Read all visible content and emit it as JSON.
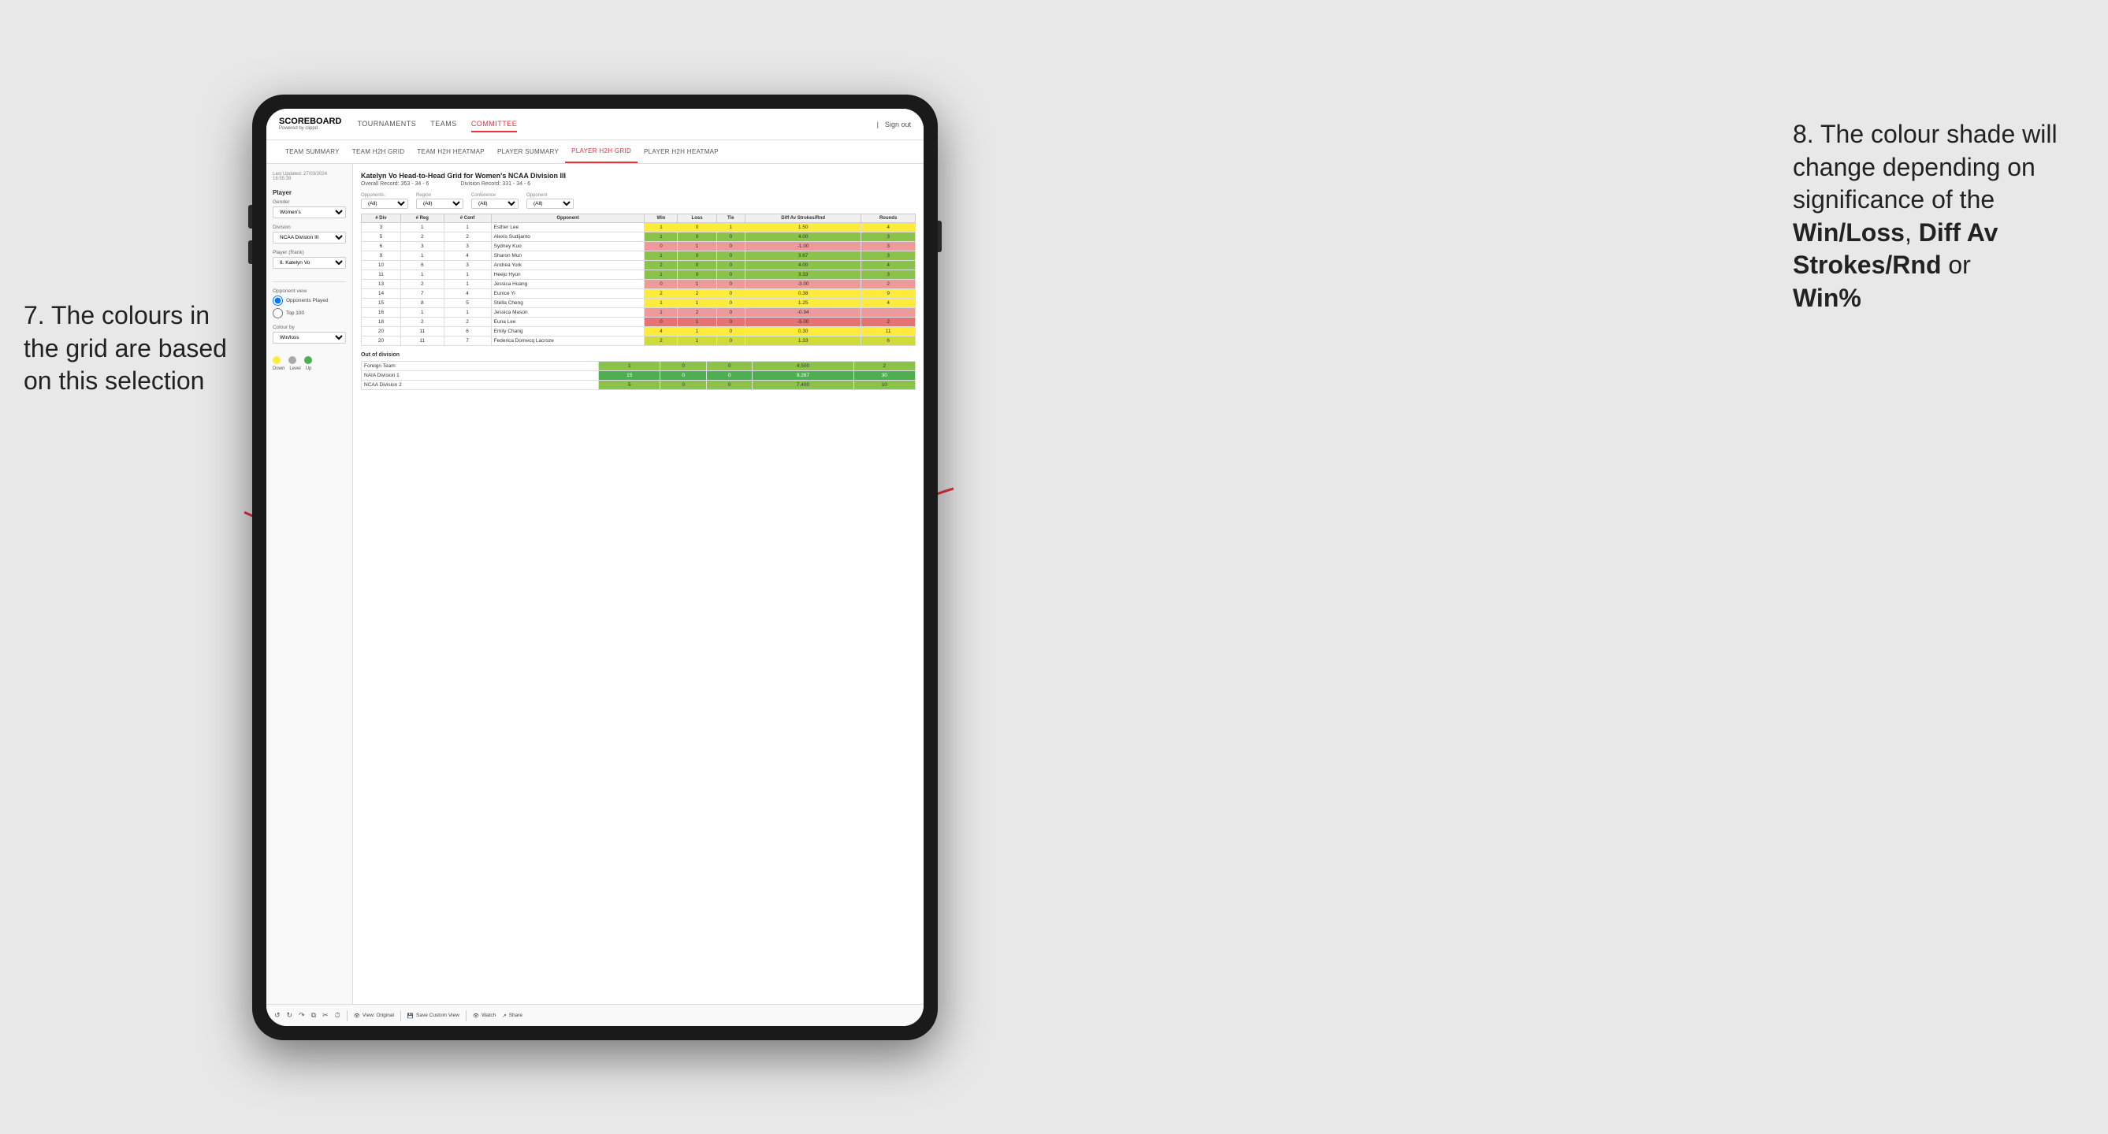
{
  "app": {
    "logo": "SCOREBOARD",
    "logo_sub": "Powered by clippd",
    "nav_items": [
      "TOURNAMENTS",
      "TEAMS",
      "COMMITTEE"
    ],
    "nav_right": [
      "Sign out"
    ],
    "sub_nav_items": [
      "TEAM SUMMARY",
      "TEAM H2H GRID",
      "TEAM H2H HEATMAP",
      "PLAYER SUMMARY",
      "PLAYER H2H GRID",
      "PLAYER H2H HEATMAP"
    ]
  },
  "sidebar": {
    "timestamp_label": "Last Updated: 27/03/2024",
    "timestamp_time": "16:55:38",
    "player_section": "Player",
    "gender_label": "Gender",
    "gender_value": "Women's",
    "division_label": "Division",
    "division_value": "NCAA Division III",
    "player_rank_label": "Player (Rank)",
    "player_rank_value": "8. Katelyn Vo",
    "opponent_view_label": "Opponent view",
    "radio_opponents": "Opponents Played",
    "radio_top100": "Top 100",
    "colour_by_label": "Colour by",
    "colour_by_value": "Win/loss",
    "legend_down": "Down",
    "legend_level": "Level",
    "legend_up": "Up"
  },
  "main": {
    "title": "Katelyn Vo Head-to-Head Grid for Women's NCAA Division III",
    "overall_record_label": "Overall Record:",
    "overall_record_value": "353 - 34 - 6",
    "division_record_label": "Division Record:",
    "division_record_value": "331 - 34 - 6",
    "filter_opponents_label": "Opponents:",
    "filter_region_label": "Region",
    "filter_conference_label": "Conference",
    "filter_opponent_label": "Opponent",
    "filter_all": "(All)",
    "columns": [
      "# Div",
      "# Reg",
      "# Conf",
      "Opponent",
      "Win",
      "Loss",
      "Tie",
      "Diff Av Strokes/Rnd",
      "Rounds"
    ],
    "rows": [
      {
        "div": "3",
        "reg": "1",
        "conf": "1",
        "name": "Esther Lee",
        "win": "1",
        "loss": "0",
        "tie": "1",
        "diff": "1.50",
        "rounds": "4",
        "color": "yellow"
      },
      {
        "div": "5",
        "reg": "2",
        "conf": "2",
        "name": "Alexis Sudijanto",
        "win": "1",
        "loss": "0",
        "tie": "0",
        "diff": "4.00",
        "rounds": "3",
        "color": "green"
      },
      {
        "div": "6",
        "reg": "3",
        "conf": "3",
        "name": "Sydney Kuo",
        "win": "0",
        "loss": "1",
        "tie": "0",
        "diff": "-1.00",
        "rounds": "3",
        "color": "red"
      },
      {
        "div": "9",
        "reg": "1",
        "conf": "4",
        "name": "Sharon Mun",
        "win": "1",
        "loss": "0",
        "tie": "0",
        "diff": "3.67",
        "rounds": "3",
        "color": "green"
      },
      {
        "div": "10",
        "reg": "6",
        "conf": "3",
        "name": "Andrea York",
        "win": "2",
        "loss": "0",
        "tie": "0",
        "diff": "4.00",
        "rounds": "4",
        "color": "green"
      },
      {
        "div": "11",
        "reg": "1",
        "conf": "1",
        "name": "Heejo Hyun",
        "win": "1",
        "loss": "0",
        "tie": "0",
        "diff": "3.33",
        "rounds": "3",
        "color": "green"
      },
      {
        "div": "13",
        "reg": "2",
        "conf": "1",
        "name": "Jessica Huang",
        "win": "0",
        "loss": "1",
        "tie": "0",
        "diff": "-3.00",
        "rounds": "2",
        "color": "red"
      },
      {
        "div": "14",
        "reg": "7",
        "conf": "4",
        "name": "Eunice Yi",
        "win": "2",
        "loss": "2",
        "tie": "0",
        "diff": "0.38",
        "rounds": "9",
        "color": "yellow"
      },
      {
        "div": "15",
        "reg": "8",
        "conf": "5",
        "name": "Stella Cheng",
        "win": "1",
        "loss": "1",
        "tie": "0",
        "diff": "1.25",
        "rounds": "4",
        "color": "yellow"
      },
      {
        "div": "16",
        "reg": "1",
        "conf": "1",
        "name": "Jessica Mason",
        "win": "1",
        "loss": "2",
        "tie": "0",
        "diff": "-0.94",
        "rounds": "",
        "color": "red"
      },
      {
        "div": "18",
        "reg": "2",
        "conf": "2",
        "name": "Euna Lee",
        "win": "0",
        "loss": "1",
        "tie": "0",
        "diff": "-5.00",
        "rounds": "2",
        "color": "red-dark"
      },
      {
        "div": "20",
        "reg": "11",
        "conf": "6",
        "name": "Emily Chang",
        "win": "4",
        "loss": "1",
        "tie": "0",
        "diff": "0.30",
        "rounds": "11",
        "color": "yellow"
      },
      {
        "div": "20",
        "reg": "11",
        "conf": "7",
        "name": "Federica Domecq Lacroze",
        "win": "2",
        "loss": "1",
        "tie": "0",
        "diff": "1.33",
        "rounds": "6",
        "color": "green-light"
      }
    ],
    "out_of_division_label": "Out of division",
    "out_rows": [
      {
        "name": "Foreign Team",
        "win": "1",
        "loss": "0",
        "tie": "0",
        "diff": "4.500",
        "rounds": "2",
        "color": "green"
      },
      {
        "name": "NAIA Division 1",
        "win": "15",
        "loss": "0",
        "tie": "0",
        "diff": "9.267",
        "rounds": "30",
        "color": "green-dark"
      },
      {
        "name": "NCAA Division 2",
        "win": "5",
        "loss": "0",
        "tie": "0",
        "diff": "7.400",
        "rounds": "10",
        "color": "green"
      }
    ]
  },
  "toolbar": {
    "view_original": "View: Original",
    "save_custom": "Save Custom View",
    "watch": "Watch",
    "share": "Share"
  },
  "annotations": {
    "left_title": "7. The colours in the grid are based on this selection",
    "right_title": "8. The colour shade will change depending on significance of the",
    "right_bold1": "Win/Loss",
    "right_bold2": "Diff Av Strokes/Rnd",
    "right_bold3": "Win%"
  }
}
